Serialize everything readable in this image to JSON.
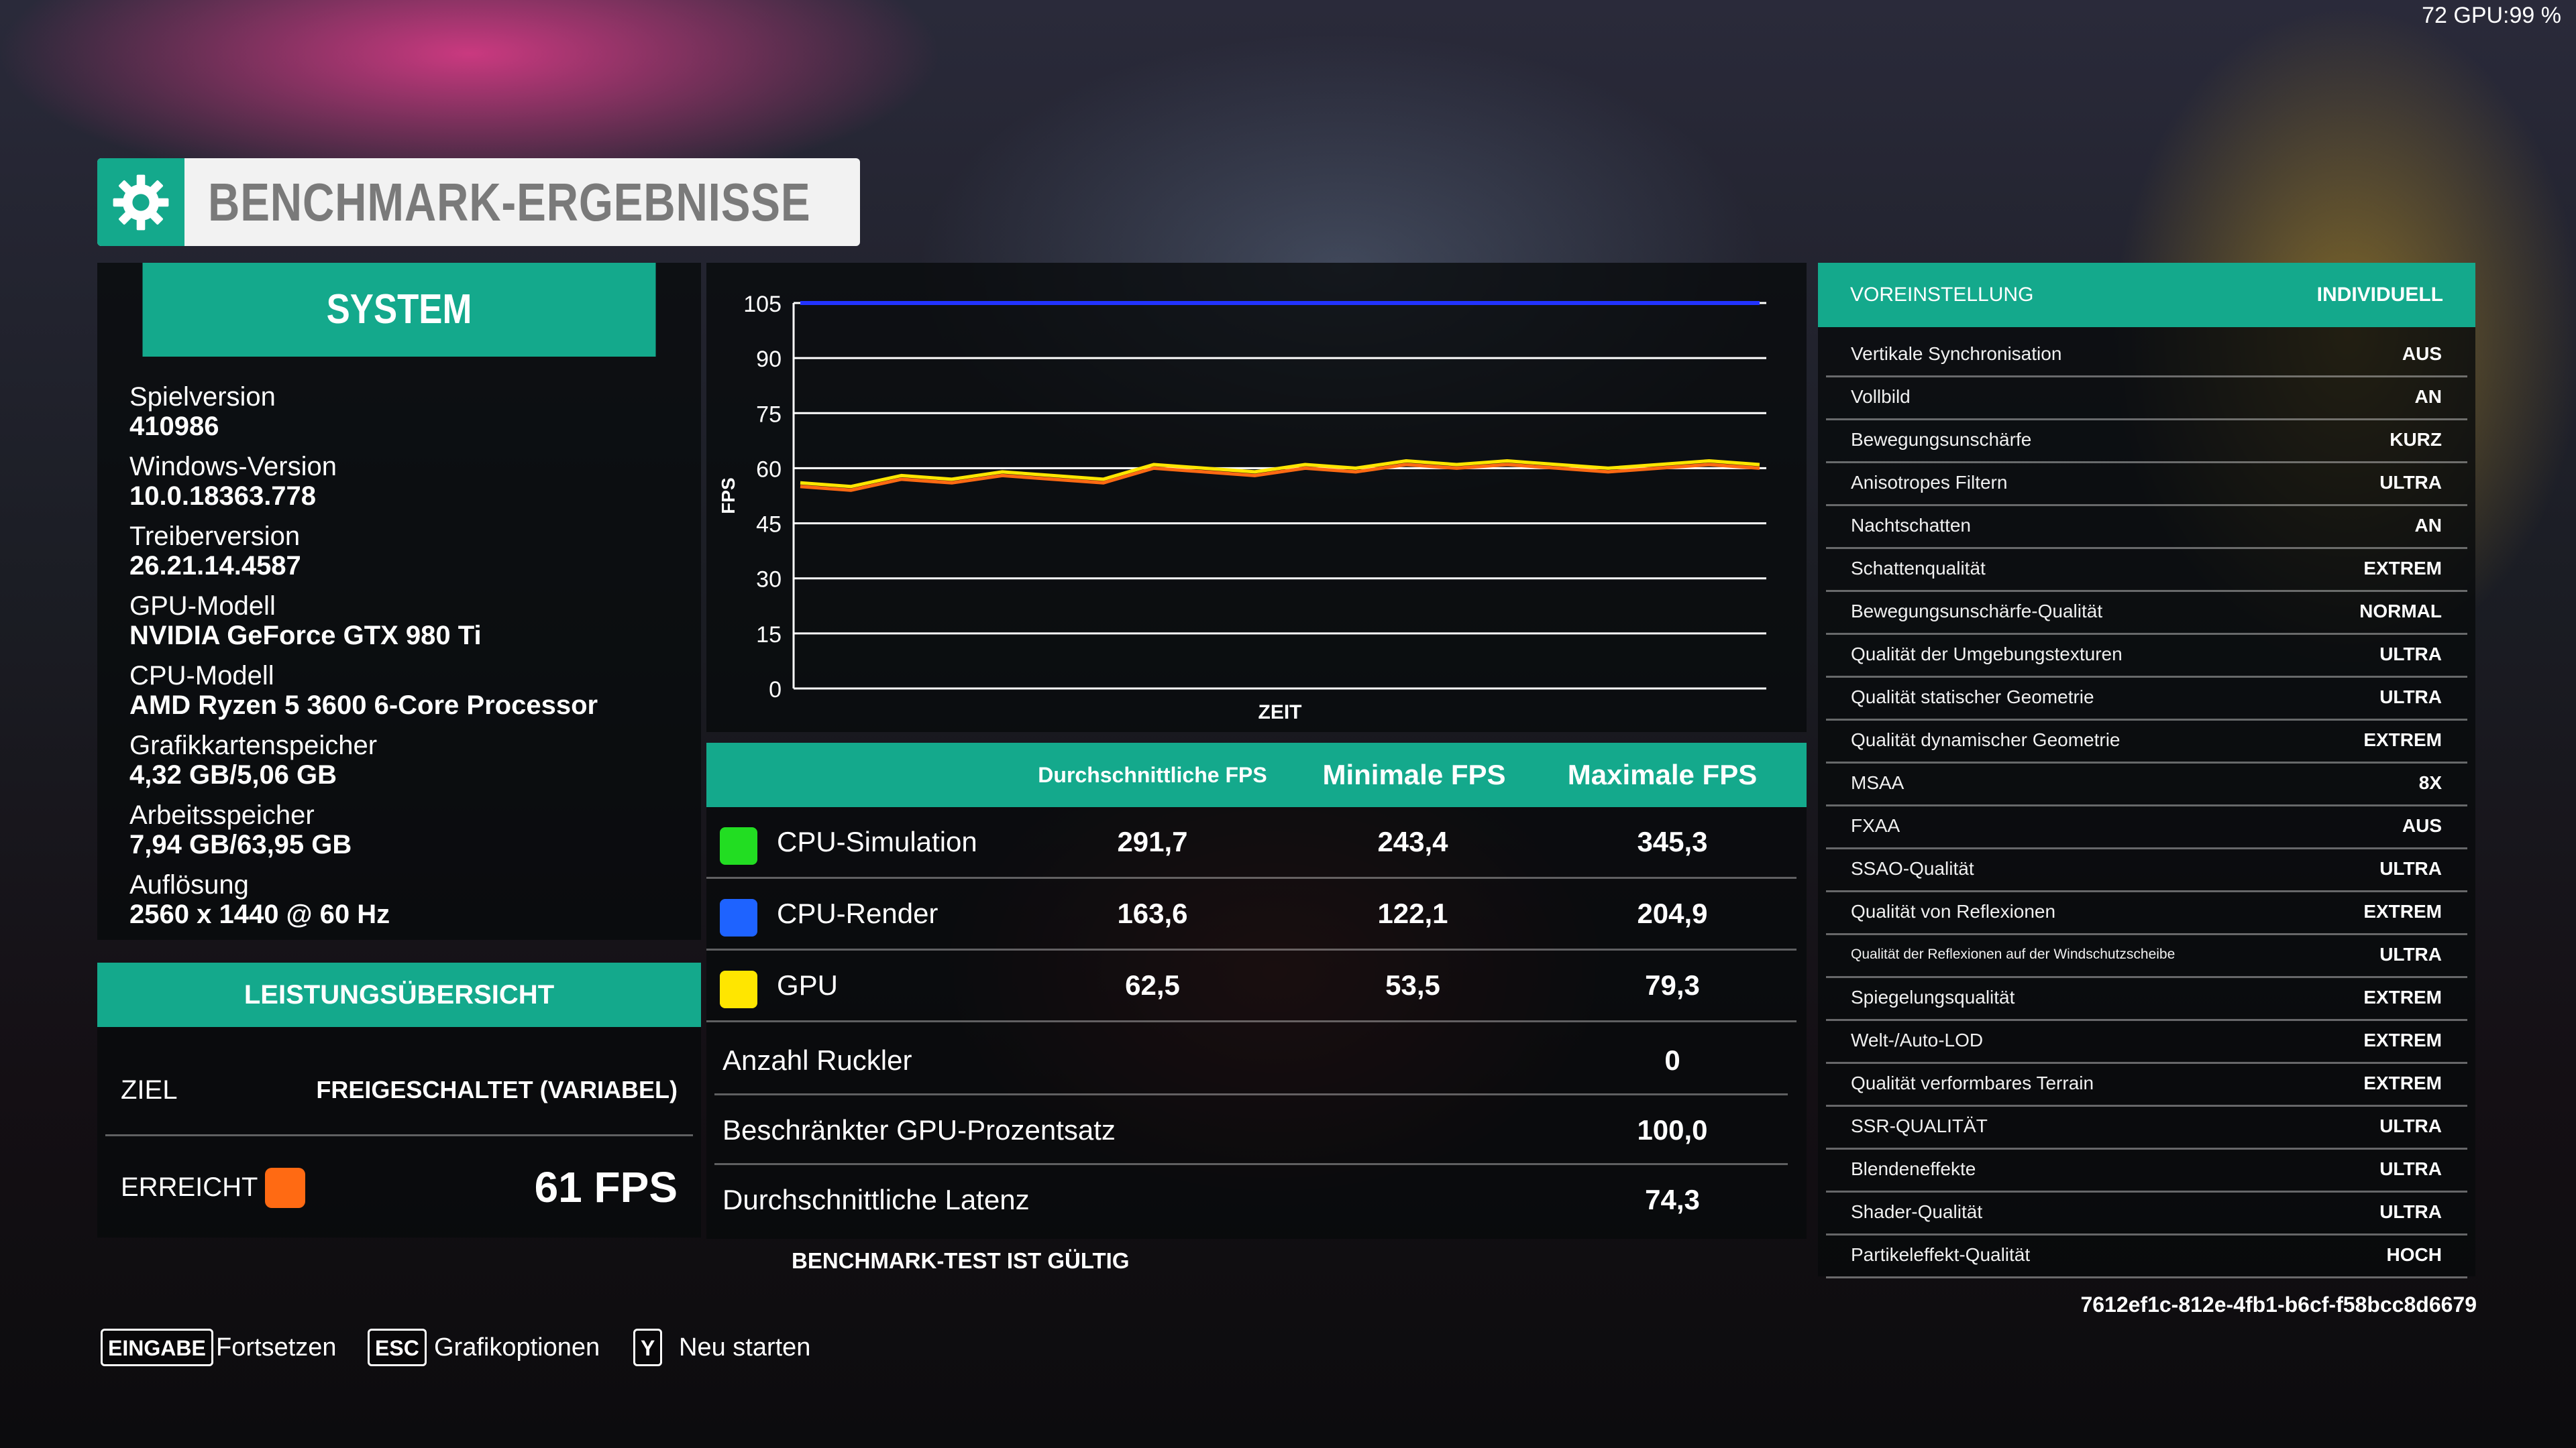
{
  "overlay": {
    "gpu_text": "72 GPU:99 %"
  },
  "header": {
    "title": "BENCHMARK-ERGEBNISSE",
    "icon": "gear-icon"
  },
  "system": {
    "title": "SYSTEM",
    "items": [
      {
        "label": "Spielversion",
        "value": "410986"
      },
      {
        "label": "Windows-Version",
        "value": "10.0.18363.778"
      },
      {
        "label": "Treiberversion",
        "value": "26.21.14.4587"
      },
      {
        "label": "GPU-Modell",
        "value": "NVIDIA GeForce GTX 980 Ti"
      },
      {
        "label": "CPU-Modell",
        "value": "AMD Ryzen 5 3600 6-Core Processor"
      },
      {
        "label": "Grafikkartenspeicher",
        "value": "4,32 GB/5,06 GB"
      },
      {
        "label": "Arbeitsspeicher",
        "value": "7,94 GB/63,95 GB"
      },
      {
        "label": "Auflösung",
        "value": "2560 x 1440 @ 60 Hz"
      }
    ]
  },
  "performance": {
    "title": "LEISTUNGSÜBERSICHT",
    "target_label": "ZIEL",
    "target_value": "FREIGESCHALTET (VARIABEL)",
    "achieved_label": "ERREICHT",
    "achieved_value": "61 FPS",
    "achieved_color": "#ff6a13"
  },
  "chart_data": {
    "type": "line",
    "title": "",
    "xlabel": "ZEIT",
    "ylabel": "FPS",
    "ylim": [
      0,
      105
    ],
    "yticks": [
      "105",
      "90",
      "75",
      "60",
      "45",
      "30",
      "15",
      "0"
    ],
    "ytick_values": [
      105,
      90,
      75,
      60,
      45,
      30,
      15,
      0
    ],
    "grid": true,
    "series": [
      {
        "color": "#2233ff",
        "values": [
          105,
          105,
          105,
          105,
          105,
          105,
          105,
          105,
          105,
          105,
          105,
          105,
          105,
          105,
          105,
          105,
          105,
          105,
          105,
          105
        ]
      },
      {
        "color": "#ffe600",
        "values": [
          56,
          55,
          58,
          57,
          59,
          58,
          57,
          61,
          60,
          59,
          61,
          60,
          62,
          61,
          62,
          61,
          60,
          61,
          62,
          61
        ]
      },
      {
        "color": "#ff6a13",
        "values": [
          55,
          54,
          57,
          56,
          58,
          57,
          56,
          60,
          59,
          58,
          60,
          59,
          61,
          60,
          61,
          60,
          59,
          60,
          61,
          60
        ]
      }
    ]
  },
  "fps_table": {
    "headers": [
      "Durchschnittliche FPS",
      "Minimale FPS",
      "Maximale FPS"
    ],
    "rows": [
      {
        "label": "CPU-Simulation",
        "color": "#22dd22",
        "avg": "291,7",
        "min": "243,4",
        "max": "345,3"
      },
      {
        "label": "CPU-Render",
        "color": "#1e63ff",
        "avg": "163,6",
        "min": "122,1",
        "max": "204,9"
      },
      {
        "label": "GPU",
        "color": "#ffe600",
        "avg": "62,5",
        "min": "53,5",
        "max": "79,3"
      }
    ],
    "extra": [
      {
        "label": "Anzahl Ruckler",
        "value": "0"
      },
      {
        "label": "Beschränkter GPU-Prozentsatz",
        "value": "100,0"
      },
      {
        "label": "Durchschnittliche Latenz",
        "value": "74,3"
      }
    ],
    "validity": "BENCHMARK-TEST IST GÜLTIG"
  },
  "settings": {
    "header_label": "VOREINSTELLUNG",
    "header_value": "INDIVIDUELL",
    "rows": [
      {
        "label": "Vertikale Synchronisation",
        "value": "AUS"
      },
      {
        "label": "Vollbild",
        "value": "AN"
      },
      {
        "label": "Bewegungsunschärfe",
        "value": "KURZ"
      },
      {
        "label": "Anisotropes Filtern",
        "value": "ULTRA"
      },
      {
        "label": "Nachtschatten",
        "value": "AN"
      },
      {
        "label": "Schattenqualität",
        "value": "EXTREM"
      },
      {
        "label": "Bewegungsunschärfe-Qualität",
        "value": "NORMAL"
      },
      {
        "label": "Qualität der Umgebungstexturen",
        "value": "ULTRA"
      },
      {
        "label": "Qualität statischer Geometrie",
        "value": "ULTRA"
      },
      {
        "label": "Qualität dynamischer Geometrie",
        "value": "EXTREM"
      },
      {
        "label": "MSAA",
        "value": "8X"
      },
      {
        "label": "FXAA",
        "value": "AUS"
      },
      {
        "label": "SSAO-Qualität",
        "value": "ULTRA"
      },
      {
        "label": "Qualität von Reflexionen",
        "value": "EXTREM"
      },
      {
        "label": "Qualität der Reflexionen auf der Windschutzscheibe",
        "value": "ULTRA"
      },
      {
        "label": "Spiegelungsqualität",
        "value": "EXTREM"
      },
      {
        "label": "Welt-/Auto-LOD",
        "value": "EXTREM"
      },
      {
        "label": "Qualität verformbares Terrain",
        "value": "EXTREM"
      },
      {
        "label": "SSR-QUALITÄT",
        "value": "ULTRA"
      },
      {
        "label": "Blendeneffekte",
        "value": "ULTRA"
      },
      {
        "label": "Shader-Qualität",
        "value": "ULTRA"
      },
      {
        "label": "Partikeleffekt-Qualität",
        "value": "HOCH"
      }
    ],
    "id": "7612ef1c-812e-4fb1-b6cf-f58bcc8d6679"
  },
  "footer": {
    "actions": [
      {
        "key": "EINGABE",
        "label": "Fortsetzen"
      },
      {
        "key": "ESC",
        "label": "Grafikoptionen"
      },
      {
        "key": "Y",
        "label": "Neu starten"
      }
    ]
  }
}
